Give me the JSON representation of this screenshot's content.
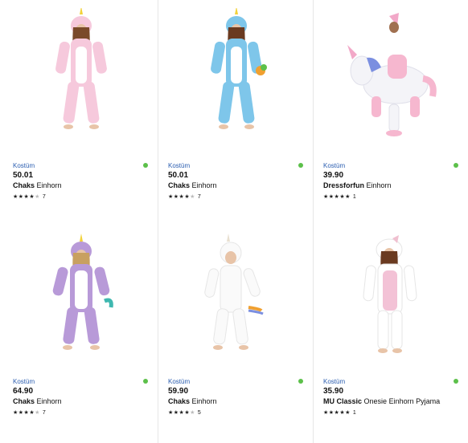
{
  "products": [
    {
      "category": "Kostüm",
      "price": "50.01",
      "brand": "Chaks",
      "name": "Einhorn",
      "rating": 4,
      "reviews": "7",
      "image": "pink unicorn onesie costume",
      "colors": {
        "body": "#f6c9dc",
        "belly": "#ffffff",
        "horn": "#f2d23a"
      }
    },
    {
      "category": "Kostüm",
      "price": "50.01",
      "brand": "Chaks",
      "name": "Einhorn",
      "rating": 4,
      "reviews": "7",
      "image": "blue unicorn onesie costume",
      "colors": {
        "body": "#7ec6ea",
        "belly": "#ffffff",
        "horn": "#f2d23a"
      }
    },
    {
      "category": "Kostüm",
      "price": "39.90",
      "brand": "Dressforfun",
      "name": "Einhorn",
      "rating": 5,
      "reviews": "1",
      "image": "inflatable unicorn rider costume",
      "colors": {
        "body": "#f4f4f8",
        "belly": "#f6b7cf",
        "horn": "#f2a8c8"
      }
    },
    {
      "category": "Kostüm",
      "price": "64.90",
      "brand": "Chaks",
      "name": "Einhorn",
      "rating": 4,
      "reviews": "7",
      "image": "purple unicorn onesie costume",
      "colors": {
        "body": "#b89ad8",
        "belly": "#ffffff",
        "horn": "#f2d23a"
      }
    },
    {
      "category": "Kostüm",
      "price": "59.90",
      "brand": "Chaks",
      "name": "Einhorn",
      "rating": 4,
      "reviews": "5",
      "image": "white unicorn onesie costume kids",
      "colors": {
        "body": "#fafafa",
        "belly": "#ffffff",
        "horn": "#e8e0d0"
      }
    },
    {
      "category": "Kostüm",
      "price": "35.90",
      "brand": "MU Classic",
      "name": "Onesie Einhorn Pyjama",
      "rating": 5,
      "reviews": "1",
      "image": "pink and white unicorn pyjama",
      "colors": {
        "body": "#f3c2d6",
        "belly": "#ffffff",
        "horn": "#f0c0d0"
      }
    }
  ],
  "availability_color": "#5cc04a",
  "category_color": "#2a5db0"
}
